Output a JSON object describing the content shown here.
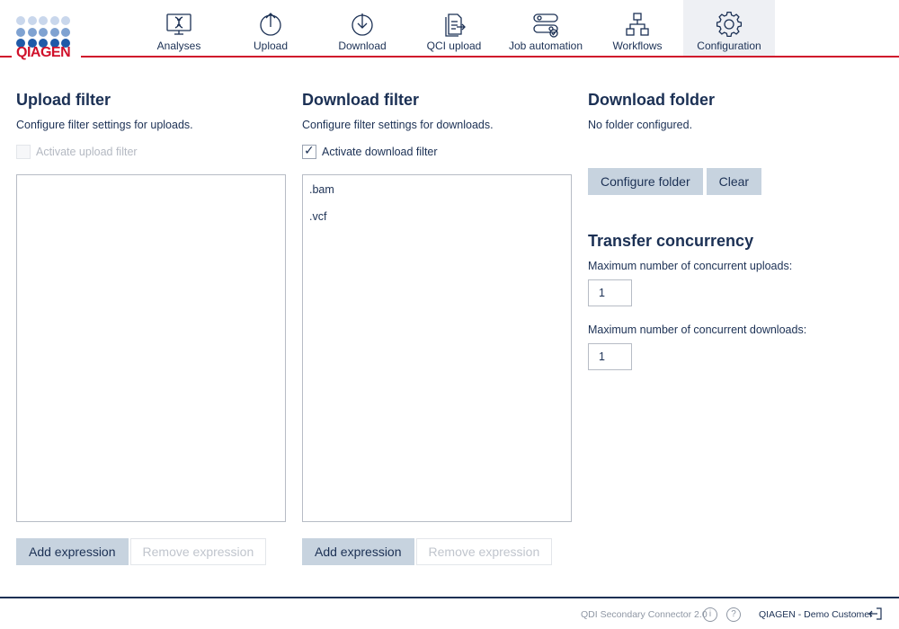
{
  "logo": {
    "text": "QIAGEN"
  },
  "nav": {
    "items": [
      {
        "label": "Analyses",
        "icon": "dna-screen-icon"
      },
      {
        "label": "Upload",
        "icon": "upload-icon"
      },
      {
        "label": "Download",
        "icon": "download-icon"
      },
      {
        "label": "QCI upload",
        "icon": "document-export-icon"
      },
      {
        "label": "Job automation",
        "icon": "automation-icon"
      },
      {
        "label": "Workflows",
        "icon": "workflow-icon"
      },
      {
        "label": "Configuration",
        "icon": "gear-icon"
      }
    ],
    "active": "Configuration"
  },
  "upload_filter": {
    "title": "Upload filter",
    "description": "Configure filter settings for uploads.",
    "checkbox_label": "Activate upload filter",
    "checked": false,
    "disabled": true,
    "expressions": [],
    "add_label": "Add expression",
    "remove_label": "Remove expression"
  },
  "download_filter": {
    "title": "Download filter",
    "description": "Configure filter settings for downloads.",
    "checkbox_label": "Activate download filter",
    "checked": true,
    "check_glyph": "✓",
    "expressions": [
      ".bam",
      ".vcf"
    ],
    "add_label": "Add expression",
    "remove_label": "Remove expression"
  },
  "download_folder": {
    "title": "Download folder",
    "status": "No folder configured.",
    "configure_label": "Configure folder",
    "clear_label": "Clear"
  },
  "transfer_concurrency": {
    "title": "Transfer concurrency",
    "uploads_label": "Maximum number of concurrent uploads:",
    "uploads_value": "1",
    "downloads_label": "Maximum number of concurrent downloads:",
    "downloads_value": "1"
  },
  "footer": {
    "version": "QDI Secondary Connector 2.0",
    "info_glyph": "i",
    "help_glyph": "?",
    "user": "QIAGEN - Demo Customer"
  },
  "colors": {
    "brand_red": "#d0112b",
    "navy": "#1b3054",
    "button_bg": "#c7d3df"
  }
}
